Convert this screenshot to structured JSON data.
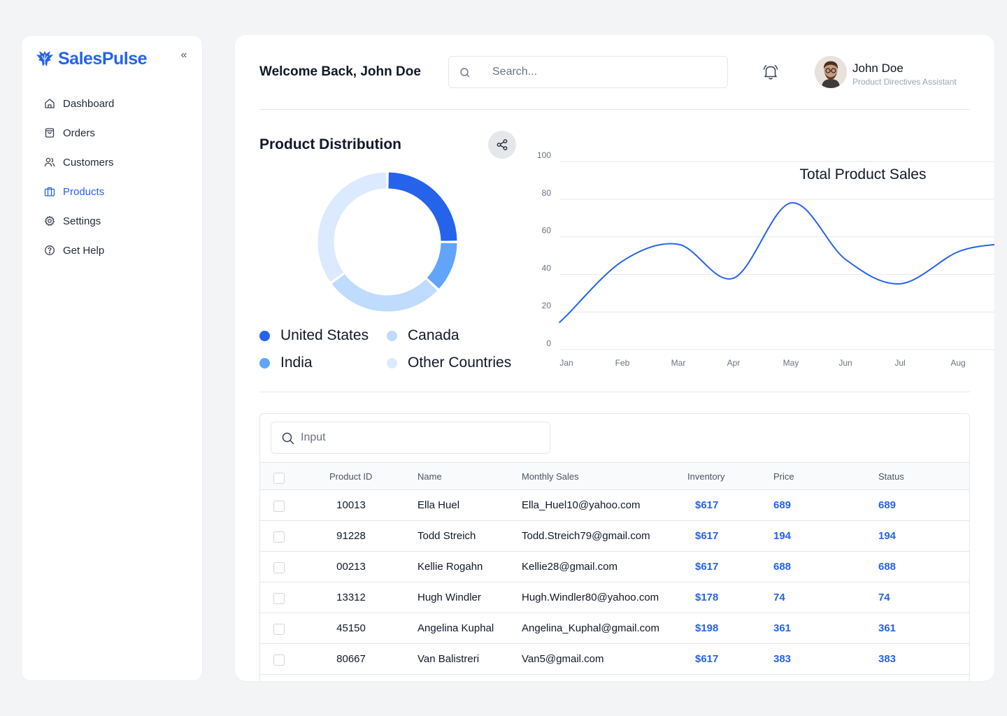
{
  "sidebar": {
    "brand": "SalesPulse",
    "collapse_icon": "«",
    "items": [
      {
        "label": "Dashboard",
        "icon": "home-icon",
        "active": false
      },
      {
        "label": "Orders",
        "icon": "shopping-bag-icon",
        "active": false
      },
      {
        "label": "Customers",
        "icon": "users-icon",
        "active": false
      },
      {
        "label": "Products",
        "icon": "briefcase-icon",
        "active": true
      },
      {
        "label": "Settings",
        "icon": "gear-icon",
        "active": false
      },
      {
        "label": "Get Help",
        "icon": "help-circle-icon",
        "active": false
      }
    ]
  },
  "header": {
    "welcome": "Welcome Back, John Doe",
    "search_placeholder": "Search...",
    "user": {
      "name": "John Doe",
      "role": "Product Directives Assistant"
    }
  },
  "distribution": {
    "title": "Product Distribution",
    "legend": [
      {
        "label": "United States",
        "color": "#2563eb"
      },
      {
        "label": "Canada",
        "color": "#bfdbfe"
      },
      {
        "label": "India",
        "color": "#60a5fa"
      },
      {
        "label": "Other Countries",
        "color": "#dbeafe"
      }
    ]
  },
  "colors": {
    "accent": "#2563eb"
  },
  "chart_data": [
    {
      "type": "pie",
      "title": "Product Distribution",
      "categories": [
        "United States",
        "India",
        "Canada",
        "Other Countries"
      ],
      "values": [
        25,
        12,
        28,
        35
      ],
      "colors": [
        "#2563eb",
        "#60a5fa",
        "#bfdbfe",
        "#dbeafe"
      ]
    },
    {
      "type": "line",
      "title": "Total Product Sales",
      "categories": [
        "Jan",
        "Feb",
        "Mar",
        "Apr",
        "May",
        "Jun",
        "Jul",
        "Aug"
      ],
      "series": [
        {
          "values": [
            18,
            47,
            56,
            38,
            78,
            48,
            35,
            52
          ]
        }
      ],
      "ylim": [
        0,
        100
      ],
      "yticks": [
        0,
        20,
        40,
        60,
        80,
        100
      ],
      "grid": true,
      "color": "#2563eb"
    }
  ],
  "table": {
    "search_placeholder": "Input",
    "columns": [
      "Product ID",
      "Name",
      "Monthly Sales",
      "Inventory",
      "Price",
      "Status"
    ],
    "rows": [
      {
        "id": "10013",
        "name": "Ella Huel",
        "sales": "Ella_Huel10@yahoo.com",
        "inventory": "$617",
        "price": "689",
        "status": "689"
      },
      {
        "id": "91228",
        "name": "Todd Streich",
        "sales": "Todd.Streich79@gmail.com",
        "inventory": "$617",
        "price": "194",
        "status": "194"
      },
      {
        "id": "00213",
        "name": "Kellie Rogahn",
        "sales": "Kellie28@gmail.com",
        "inventory": "$617",
        "price": "688",
        "status": "688"
      },
      {
        "id": "13312",
        "name": "Hugh Windler",
        "sales": "Hugh.Windler80@yahoo.com",
        "inventory": "$178",
        "price": "74",
        "status": "74"
      },
      {
        "id": "45150",
        "name": "Angelina Kuphal",
        "sales": "Angelina_Kuphal@gmail.com",
        "inventory": "$198",
        "price": "361",
        "status": "361"
      },
      {
        "id": "80667",
        "name": "Van Balistreri",
        "sales": "Van5@gmail.com",
        "inventory": "$617",
        "price": "383",
        "status": "383"
      }
    ]
  }
}
